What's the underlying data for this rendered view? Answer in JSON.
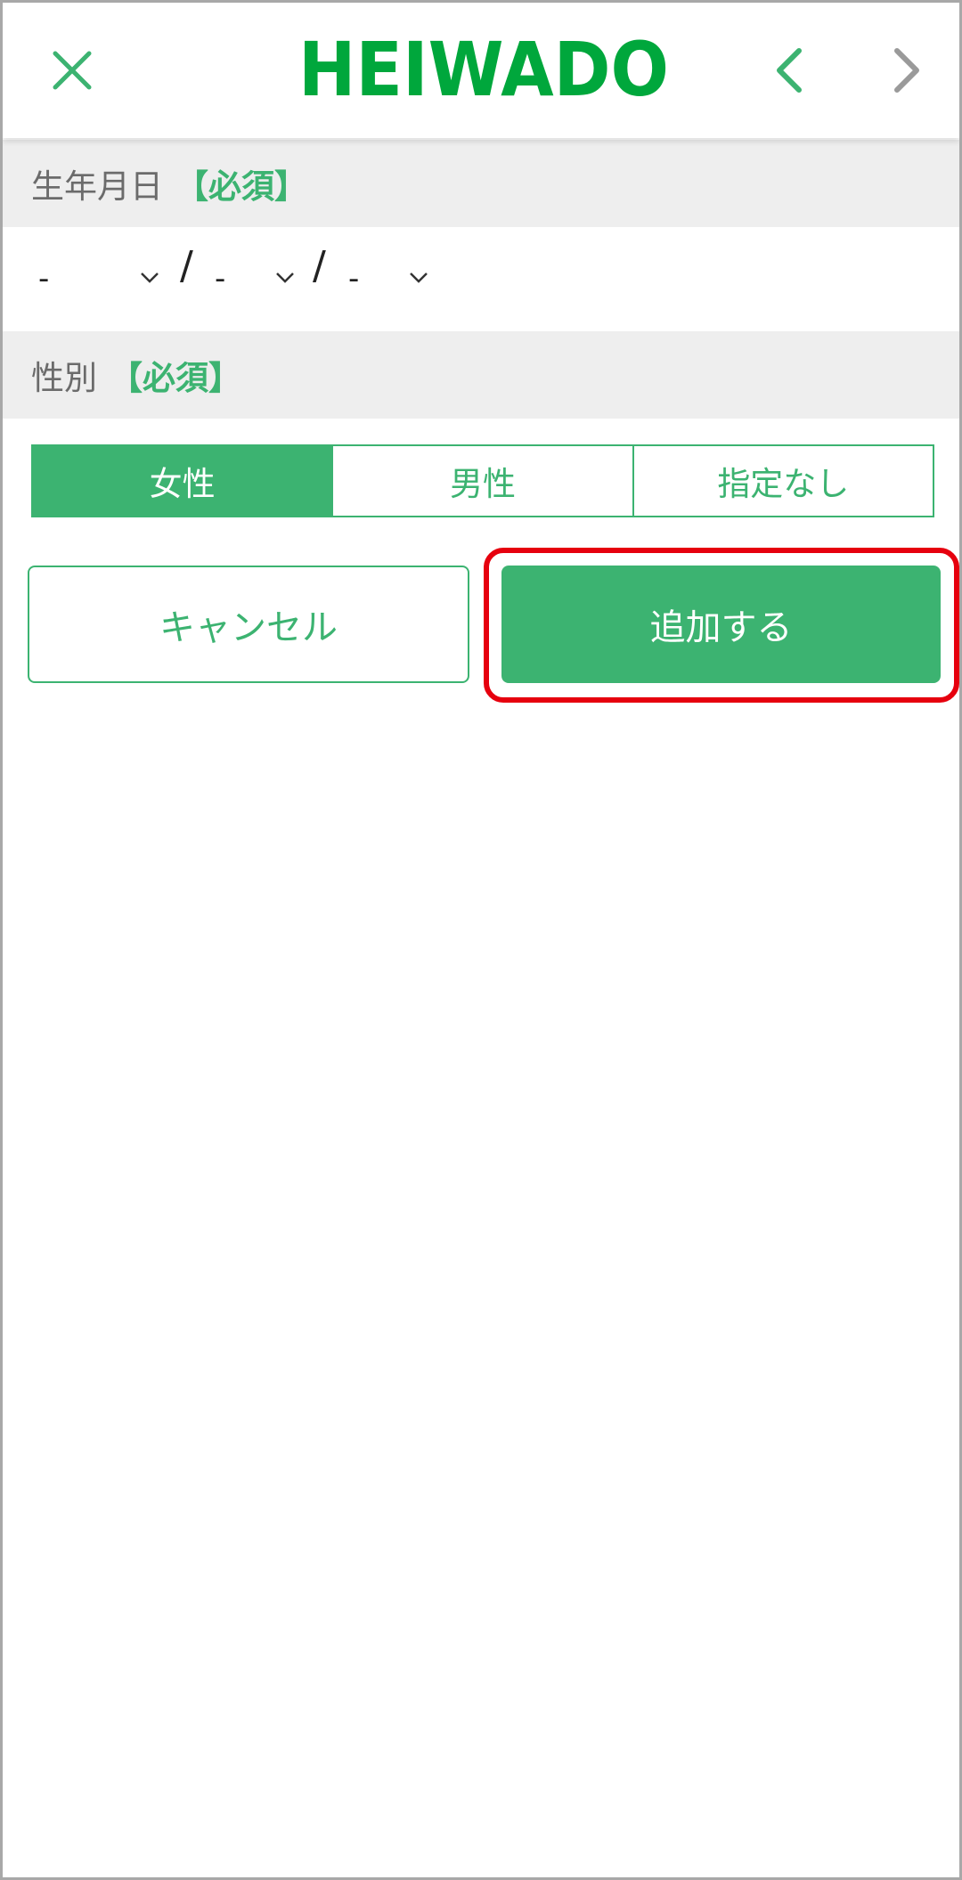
{
  "header": {
    "logo_text": "HEIWADO",
    "brand_color": "#00a73c",
    "close_icon": "close-icon",
    "prev_icon": "chevron-left-icon",
    "next_icon": "chevron-right-icon"
  },
  "dob_section": {
    "label": "生年月日",
    "required": "【必須】",
    "year_value": "-",
    "month_value": "-",
    "day_value": "-",
    "separator": "/"
  },
  "gender_section": {
    "label": "性別",
    "required": "【必須】",
    "options": [
      "女性",
      "男性",
      "指定なし"
    ],
    "selected": "女性"
  },
  "actions": {
    "cancel_label": "キャンセル",
    "add_label": "追加する"
  },
  "colors": {
    "accent": "#3cb371",
    "highlight": "#e6000e"
  }
}
